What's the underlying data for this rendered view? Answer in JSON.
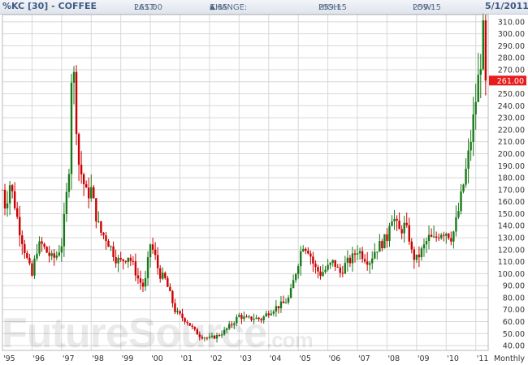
{
  "header": {
    "symbol": "%KC [30] - COFFEE",
    "last_label": "LAST:",
    "last_value": "261.00",
    "change_label": "CHANGE:",
    "change_value": "1.85",
    "high_label": "HIGH:",
    "high_value": "259.15",
    "low_label": "LOW:",
    "low_value": "259.15",
    "date": "5/1/2011"
  },
  "watermark": {
    "main": "FutureSource",
    "suffix": ".com"
  },
  "colors": {
    "up": "#1a7a1a",
    "down": "#cc0000",
    "grid": "#d8d8d8",
    "last_price_tag": "#e81c1c",
    "header_text": "#3f5a85"
  },
  "chart_data": {
    "type": "candlestick",
    "frequency_label": "Monthly",
    "x_tick_labels": [
      "'95",
      "'96",
      "'97",
      "'98",
      "'99",
      "'00",
      "'01",
      "'02",
      "'03",
      "'04",
      "'05",
      "'06",
      "'07",
      "'08",
      "'09",
      "'10",
      "'11"
    ],
    "y_tick_labels": [
      "40.00",
      "50.00",
      "60.00",
      "70.00",
      "80.00",
      "90.00",
      "100.00",
      "110.00",
      "120.00",
      "130.00",
      "140.00",
      "150.00",
      "160.00",
      "170.00",
      "180.00",
      "190.00",
      "200.00",
      "210.00",
      "220.00",
      "230.00",
      "240.00",
      "250.00",
      "260.00",
      "270.00",
      "280.00",
      "290.00",
      "300.00",
      "310.00"
    ],
    "ylim": [
      36,
      316
    ],
    "xlim": [
      1995.0,
      2011.42
    ],
    "grid": true,
    "last_price_label": "261.00",
    "last_price": 261,
    "anchors": [
      [
        1995.0,
        170
      ],
      [
        1995.1,
        155
      ],
      [
        1995.25,
        175
      ],
      [
        1995.4,
        160
      ],
      [
        1995.55,
        140
      ],
      [
        1995.7,
        125
      ],
      [
        1995.85,
        110
      ],
      [
        1996.0,
        98
      ],
      [
        1996.15,
        120
      ],
      [
        1996.3,
        125
      ],
      [
        1996.5,
        118
      ],
      [
        1996.7,
        112
      ],
      [
        1996.85,
        116
      ],
      [
        1997.0,
        125
      ],
      [
        1997.15,
        160
      ],
      [
        1997.25,
        190
      ],
      [
        1997.35,
        280
      ],
      [
        1997.45,
        255
      ],
      [
        1997.55,
        195
      ],
      [
        1997.7,
        180
      ],
      [
        1997.85,
        165
      ],
      [
        1998.0,
        170
      ],
      [
        1998.15,
        150
      ],
      [
        1998.3,
        135
      ],
      [
        1998.5,
        130
      ],
      [
        1998.7,
        120
      ],
      [
        1998.85,
        112
      ],
      [
        1999.0,
        110
      ],
      [
        1999.25,
        115
      ],
      [
        1999.4,
        108
      ],
      [
        1999.6,
        95
      ],
      [
        1999.8,
        88
      ],
      [
        2000.0,
        125
      ],
      [
        2000.15,
        115
      ],
      [
        2000.3,
        100
      ],
      [
        2000.5,
        95
      ],
      [
        2000.7,
        80
      ],
      [
        2000.85,
        68
      ],
      [
        2001.0,
        65
      ],
      [
        2001.25,
        60
      ],
      [
        2001.5,
        52
      ],
      [
        2001.7,
        48
      ],
      [
        2002.0,
        46
      ],
      [
        2002.25,
        48
      ],
      [
        2002.5,
        52
      ],
      [
        2002.75,
        58
      ],
      [
        2003.0,
        65
      ],
      [
        2003.25,
        62
      ],
      [
        2003.5,
        63
      ],
      [
        2003.75,
        62
      ],
      [
        2004.0,
        68
      ],
      [
        2004.25,
        72
      ],
      [
        2004.5,
        75
      ],
      [
        2004.7,
        80
      ],
      [
        2004.85,
        95
      ],
      [
        2005.0,
        110
      ],
      [
        2005.15,
        125
      ],
      [
        2005.35,
        120
      ],
      [
        2005.55,
        105
      ],
      [
        2005.75,
        100
      ],
      [
        2006.0,
        105
      ],
      [
        2006.2,
        110
      ],
      [
        2006.4,
        100
      ],
      [
        2006.6,
        108
      ],
      [
        2006.8,
        112
      ],
      [
        2007.0,
        120
      ],
      [
        2007.2,
        115
      ],
      [
        2007.4,
        110
      ],
      [
        2007.6,
        120
      ],
      [
        2007.8,
        125
      ],
      [
        2008.0,
        130
      ],
      [
        2008.12,
        150
      ],
      [
        2008.25,
        145
      ],
      [
        2008.4,
        135
      ],
      [
        2008.6,
        140
      ],
      [
        2008.75,
        130
      ],
      [
        2008.85,
        115
      ],
      [
        2009.0,
        112
      ],
      [
        2009.2,
        120
      ],
      [
        2009.4,
        130
      ],
      [
        2009.6,
        128
      ],
      [
        2009.8,
        135
      ],
      [
        2010.0,
        135
      ],
      [
        2010.2,
        130
      ],
      [
        2010.4,
        150
      ],
      [
        2010.55,
        170
      ],
      [
        2010.7,
        190
      ],
      [
        2010.85,
        215
      ],
      [
        2011.0,
        245
      ],
      [
        2011.15,
        275
      ],
      [
        2011.25,
        300
      ],
      [
        2011.33,
        261
      ]
    ]
  }
}
